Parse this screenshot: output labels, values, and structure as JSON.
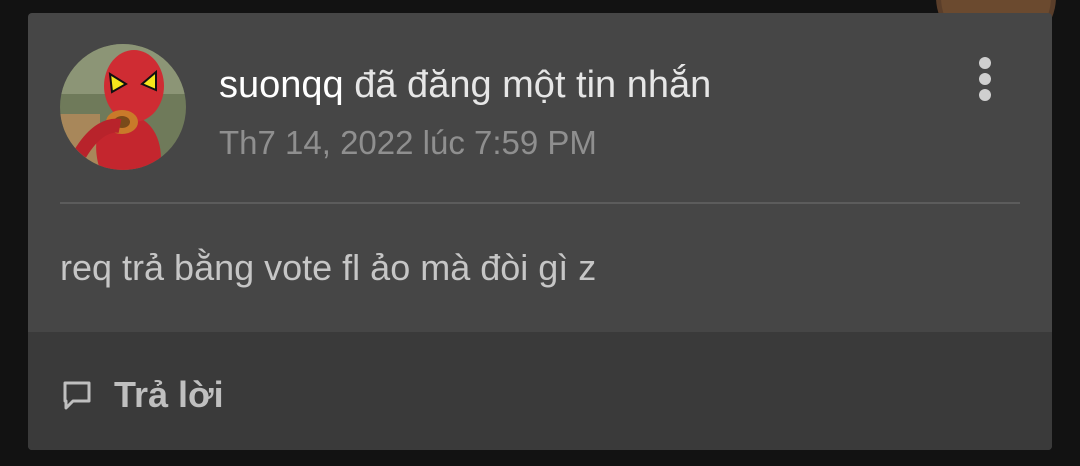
{
  "post": {
    "username": "suonqq",
    "action": "đã đăng một tin nhắn",
    "timestamp": "Th7 14, 2022 lúc 7:59 PM",
    "message": "req trả bằng vote fl ảo mà đòi gì z",
    "avatar_icon": "spider-man-avatar"
  },
  "menu": {
    "icon": "more-vertical-icon"
  },
  "footer": {
    "reply_label": "Trả lời",
    "reply_icon": "comment-icon"
  },
  "colors": {
    "page_background": "#121212",
    "card_background": "#464646",
    "footer_background": "#3a3a3a",
    "username": "#ffffff",
    "timestamp": "#8f8f8f",
    "message": "#c6c6c6"
  }
}
